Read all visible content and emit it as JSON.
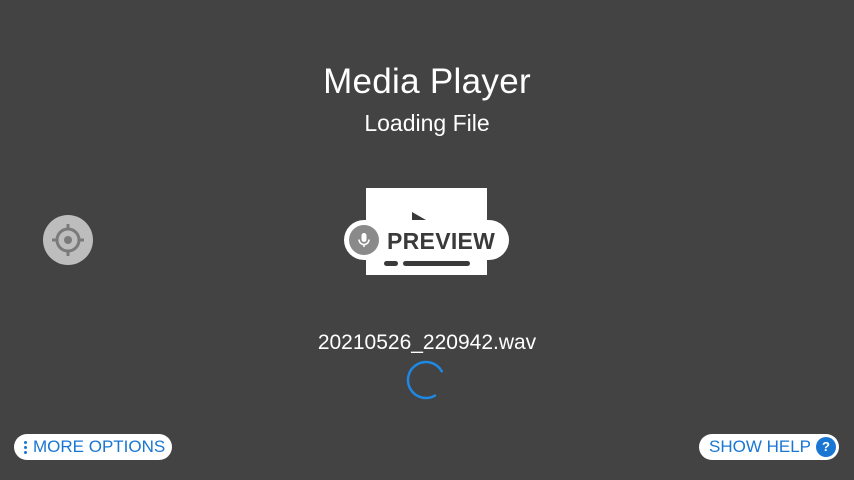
{
  "app": {
    "title": "Media Player",
    "status": "Loading File"
  },
  "preview": {
    "label": "PREVIEW",
    "icon": "microphone-icon"
  },
  "file": {
    "name": "20210526_220942.wav"
  },
  "controls": {
    "target_icon": "crosshair-target-icon",
    "more_options_label": "MORE OPTIONS",
    "more_options_icon": "vertical-dots-icon",
    "show_help_label": "SHOW HELP",
    "help_icon_glyph": "?"
  },
  "colors": {
    "background": "#434343",
    "accent": "#1976d2",
    "spinner": "#1e88e5",
    "target_button": "#bdbdbd",
    "text": "#ffffff"
  }
}
